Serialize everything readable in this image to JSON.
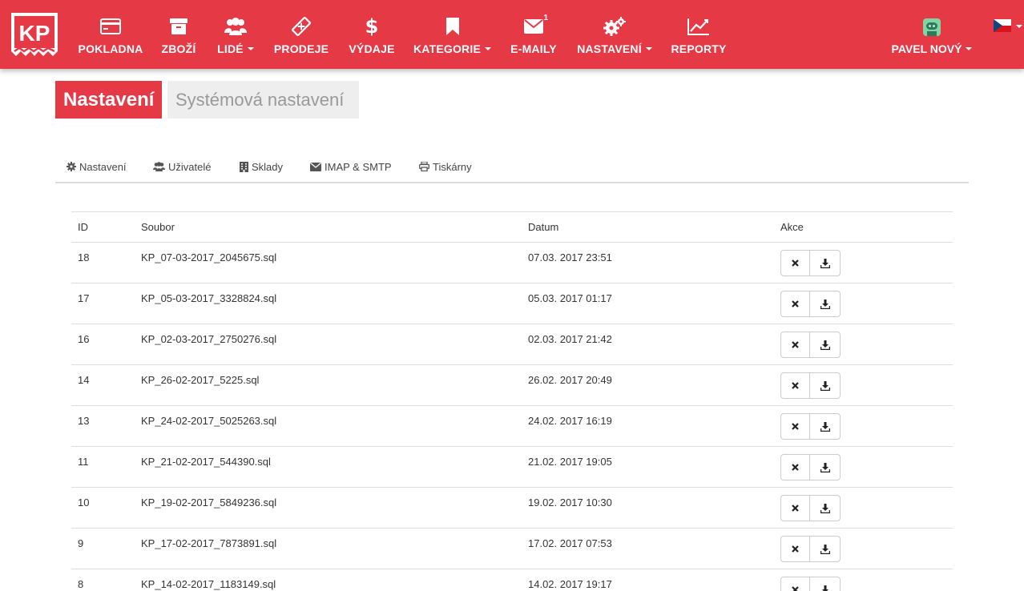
{
  "logo_text": "KP",
  "nav": [
    {
      "label": "POKLADNA",
      "icon": "credit-card-icon"
    },
    {
      "label": "ZBOŽÍ",
      "icon": "archive-box-icon"
    },
    {
      "label": "LIDÉ",
      "icon": "users-icon",
      "dropdown": true
    },
    {
      "label": "PRODEJE",
      "icon": "ticket-icon"
    },
    {
      "label": "VÝDAJE",
      "icon": "dollar-icon"
    },
    {
      "label": "KATEGORIE",
      "icon": "bookmark-icon",
      "dropdown": true
    },
    {
      "label": "E-MAILY",
      "icon": "envelope-icon",
      "badge": "1"
    },
    {
      "label": "NASTAVENÍ",
      "icon": "gears-icon",
      "dropdown": true
    },
    {
      "label": "REPORTY",
      "icon": "line-chart-icon"
    }
  ],
  "user": {
    "name": "PAVEL NOVÝ"
  },
  "page_title": {
    "primary": "Nastavení",
    "secondary": "Systémová nastavení"
  },
  "tabs": [
    {
      "label": "Nastavení",
      "icon": "gear-icon"
    },
    {
      "label": "Uživatelé",
      "icon": "users-icon"
    },
    {
      "label": "Sklady",
      "icon": "building-icon"
    },
    {
      "label": "IMAP & SMTP",
      "icon": "envelope-icon"
    },
    {
      "label": "Tiskárny",
      "icon": "printer-icon"
    }
  ],
  "table": {
    "headers": {
      "id": "ID",
      "file": "Soubor",
      "date": "Datum",
      "actions": "Akce"
    },
    "rows": [
      {
        "id": "18",
        "file": "KP_07-03-2017_2045675.sql",
        "date": "07.03. 2017 23:51"
      },
      {
        "id": "17",
        "file": "KP_05-03-2017_3328824.sql",
        "date": "05.03. 2017 01:17"
      },
      {
        "id": "16",
        "file": "KP_02-03-2017_2750276.sql",
        "date": "02.03. 2017 21:42"
      },
      {
        "id": "14",
        "file": "KP_26-02-2017_5225.sql",
        "date": "26.02. 2017 20:49"
      },
      {
        "id": "13",
        "file": "KP_24-02-2017_5025263.sql",
        "date": "24.02. 2017 16:19"
      },
      {
        "id": "11",
        "file": "KP_21-02-2017_544390.sql",
        "date": "21.02. 2017 19:05"
      },
      {
        "id": "10",
        "file": "KP_19-02-2017_5849236.sql",
        "date": "19.02. 2017 10:30"
      },
      {
        "id": "9",
        "file": "KP_17-02-2017_7873891.sql",
        "date": "17.02. 2017 07:53"
      },
      {
        "id": "8",
        "file": "KP_14-02-2017_1183149.sql",
        "date": "14.02. 2017 19:17"
      }
    ]
  },
  "colors": {
    "brand_red": "#e63946",
    "secondary_bg": "#eeeeee",
    "border": "#dddddd"
  }
}
